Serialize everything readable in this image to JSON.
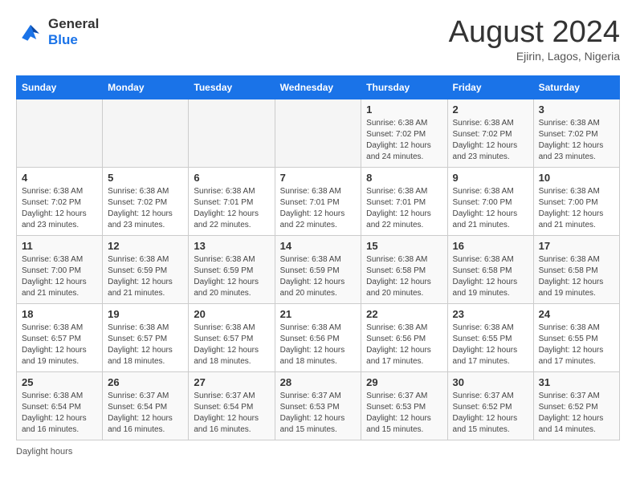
{
  "logo": {
    "line1": "General",
    "line2": "Blue"
  },
  "title": "August 2024",
  "subtitle": "Ejirin, Lagos, Nigeria",
  "days_of_week": [
    "Sunday",
    "Monday",
    "Tuesday",
    "Wednesday",
    "Thursday",
    "Friday",
    "Saturday"
  ],
  "weeks": [
    [
      {
        "day": "",
        "sunrise": "",
        "sunset": "",
        "daylight": ""
      },
      {
        "day": "",
        "sunrise": "",
        "sunset": "",
        "daylight": ""
      },
      {
        "day": "",
        "sunrise": "",
        "sunset": "",
        "daylight": ""
      },
      {
        "day": "",
        "sunrise": "",
        "sunset": "",
        "daylight": ""
      },
      {
        "day": "1",
        "sunrise": "Sunrise: 6:38 AM",
        "sunset": "Sunset: 7:02 PM",
        "daylight": "Daylight: 12 hours and 24 minutes."
      },
      {
        "day": "2",
        "sunrise": "Sunrise: 6:38 AM",
        "sunset": "Sunset: 7:02 PM",
        "daylight": "Daylight: 12 hours and 23 minutes."
      },
      {
        "day": "3",
        "sunrise": "Sunrise: 6:38 AM",
        "sunset": "Sunset: 7:02 PM",
        "daylight": "Daylight: 12 hours and 23 minutes."
      }
    ],
    [
      {
        "day": "4",
        "sunrise": "Sunrise: 6:38 AM",
        "sunset": "Sunset: 7:02 PM",
        "daylight": "Daylight: 12 hours and 23 minutes."
      },
      {
        "day": "5",
        "sunrise": "Sunrise: 6:38 AM",
        "sunset": "Sunset: 7:02 PM",
        "daylight": "Daylight: 12 hours and 23 minutes."
      },
      {
        "day": "6",
        "sunrise": "Sunrise: 6:38 AM",
        "sunset": "Sunset: 7:01 PM",
        "daylight": "Daylight: 12 hours and 22 minutes."
      },
      {
        "day": "7",
        "sunrise": "Sunrise: 6:38 AM",
        "sunset": "Sunset: 7:01 PM",
        "daylight": "Daylight: 12 hours and 22 minutes."
      },
      {
        "day": "8",
        "sunrise": "Sunrise: 6:38 AM",
        "sunset": "Sunset: 7:01 PM",
        "daylight": "Daylight: 12 hours and 22 minutes."
      },
      {
        "day": "9",
        "sunrise": "Sunrise: 6:38 AM",
        "sunset": "Sunset: 7:00 PM",
        "daylight": "Daylight: 12 hours and 21 minutes."
      },
      {
        "day": "10",
        "sunrise": "Sunrise: 6:38 AM",
        "sunset": "Sunset: 7:00 PM",
        "daylight": "Daylight: 12 hours and 21 minutes."
      }
    ],
    [
      {
        "day": "11",
        "sunrise": "Sunrise: 6:38 AM",
        "sunset": "Sunset: 7:00 PM",
        "daylight": "Daylight: 12 hours and 21 minutes."
      },
      {
        "day": "12",
        "sunrise": "Sunrise: 6:38 AM",
        "sunset": "Sunset: 6:59 PM",
        "daylight": "Daylight: 12 hours and 21 minutes."
      },
      {
        "day": "13",
        "sunrise": "Sunrise: 6:38 AM",
        "sunset": "Sunset: 6:59 PM",
        "daylight": "Daylight: 12 hours and 20 minutes."
      },
      {
        "day": "14",
        "sunrise": "Sunrise: 6:38 AM",
        "sunset": "Sunset: 6:59 PM",
        "daylight": "Daylight: 12 hours and 20 minutes."
      },
      {
        "day": "15",
        "sunrise": "Sunrise: 6:38 AM",
        "sunset": "Sunset: 6:58 PM",
        "daylight": "Daylight: 12 hours and 20 minutes."
      },
      {
        "day": "16",
        "sunrise": "Sunrise: 6:38 AM",
        "sunset": "Sunset: 6:58 PM",
        "daylight": "Daylight: 12 hours and 19 minutes."
      },
      {
        "day": "17",
        "sunrise": "Sunrise: 6:38 AM",
        "sunset": "Sunset: 6:58 PM",
        "daylight": "Daylight: 12 hours and 19 minutes."
      }
    ],
    [
      {
        "day": "18",
        "sunrise": "Sunrise: 6:38 AM",
        "sunset": "Sunset: 6:57 PM",
        "daylight": "Daylight: 12 hours and 19 minutes."
      },
      {
        "day": "19",
        "sunrise": "Sunrise: 6:38 AM",
        "sunset": "Sunset: 6:57 PM",
        "daylight": "Daylight: 12 hours and 18 minutes."
      },
      {
        "day": "20",
        "sunrise": "Sunrise: 6:38 AM",
        "sunset": "Sunset: 6:57 PM",
        "daylight": "Daylight: 12 hours and 18 minutes."
      },
      {
        "day": "21",
        "sunrise": "Sunrise: 6:38 AM",
        "sunset": "Sunset: 6:56 PM",
        "daylight": "Daylight: 12 hours and 18 minutes."
      },
      {
        "day": "22",
        "sunrise": "Sunrise: 6:38 AM",
        "sunset": "Sunset: 6:56 PM",
        "daylight": "Daylight: 12 hours and 17 minutes."
      },
      {
        "day": "23",
        "sunrise": "Sunrise: 6:38 AM",
        "sunset": "Sunset: 6:55 PM",
        "daylight": "Daylight: 12 hours and 17 minutes."
      },
      {
        "day": "24",
        "sunrise": "Sunrise: 6:38 AM",
        "sunset": "Sunset: 6:55 PM",
        "daylight": "Daylight: 12 hours and 17 minutes."
      }
    ],
    [
      {
        "day": "25",
        "sunrise": "Sunrise: 6:38 AM",
        "sunset": "Sunset: 6:54 PM",
        "daylight": "Daylight: 12 hours and 16 minutes."
      },
      {
        "day": "26",
        "sunrise": "Sunrise: 6:37 AM",
        "sunset": "Sunset: 6:54 PM",
        "daylight": "Daylight: 12 hours and 16 minutes."
      },
      {
        "day": "27",
        "sunrise": "Sunrise: 6:37 AM",
        "sunset": "Sunset: 6:54 PM",
        "daylight": "Daylight: 12 hours and 16 minutes."
      },
      {
        "day": "28",
        "sunrise": "Sunrise: 6:37 AM",
        "sunset": "Sunset: 6:53 PM",
        "daylight": "Daylight: 12 hours and 15 minutes."
      },
      {
        "day": "29",
        "sunrise": "Sunrise: 6:37 AM",
        "sunset": "Sunset: 6:53 PM",
        "daylight": "Daylight: 12 hours and 15 minutes."
      },
      {
        "day": "30",
        "sunrise": "Sunrise: 6:37 AM",
        "sunset": "Sunset: 6:52 PM",
        "daylight": "Daylight: 12 hours and 15 minutes."
      },
      {
        "day": "31",
        "sunrise": "Sunrise: 6:37 AM",
        "sunset": "Sunset: 6:52 PM",
        "daylight": "Daylight: 12 hours and 14 minutes."
      }
    ]
  ],
  "footer": {
    "daylight_label": "Daylight hours"
  }
}
